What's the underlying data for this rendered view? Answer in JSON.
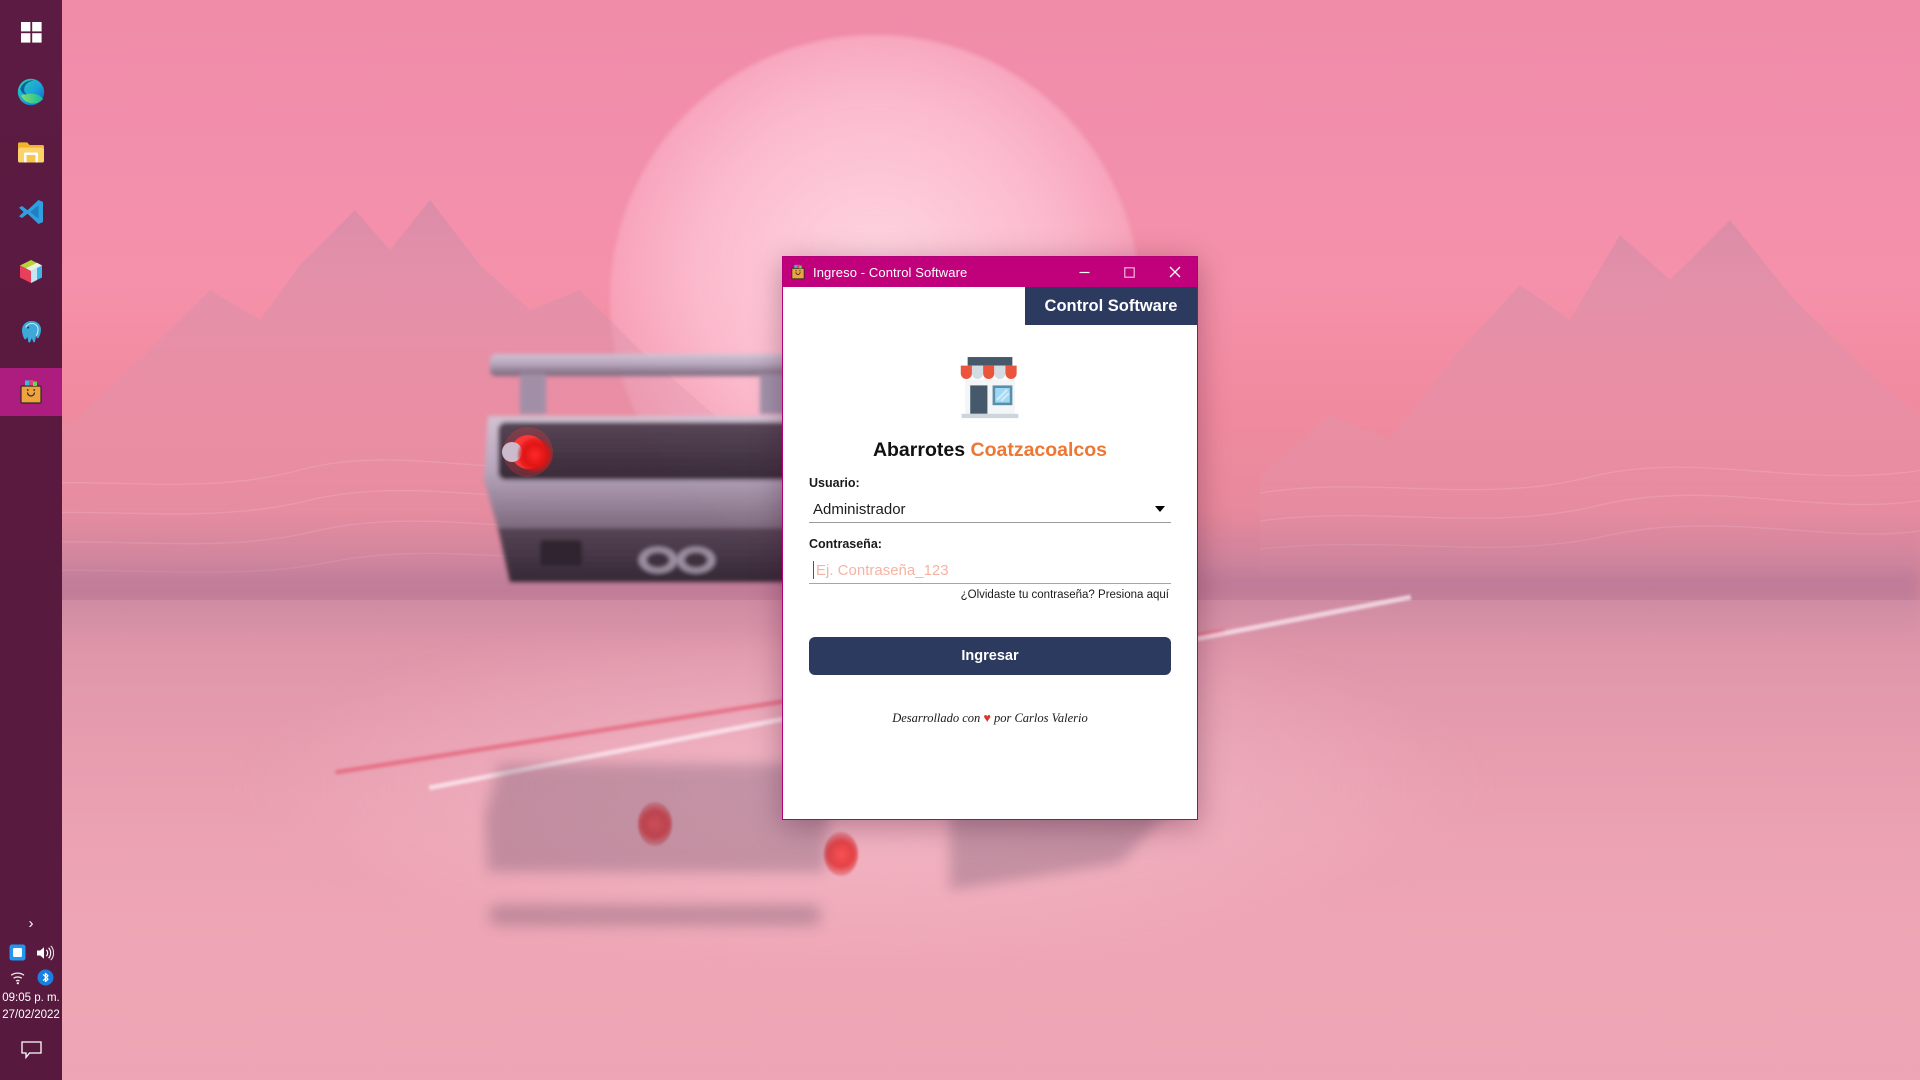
{
  "desktop": {
    "wallpaper_description": "synthwave pink sunset with mountains, sun and sports car on wet salt flat",
    "accent_magenta": "#c1007c",
    "taskbar_color": "#5a1a40",
    "navy": "#2d3a5f",
    "orange": "#ee7733",
    "salmon": "#ef8b72"
  },
  "taskbar": {
    "items": [
      {
        "name": "start-button",
        "icon": "windows-logo-icon",
        "label": "Inicio",
        "active": false
      },
      {
        "name": "taskbar-item-edge",
        "icon": "microsoft-edge-icon",
        "label": "Microsoft Edge",
        "active": false
      },
      {
        "name": "taskbar-item-file-explorer",
        "icon": "folder-icon",
        "label": "Explorador de archivos",
        "active": false
      },
      {
        "name": "taskbar-item-vscode",
        "icon": "vs-code-icon",
        "label": "Visual Studio Code",
        "active": false
      },
      {
        "name": "taskbar-item-3d-viewer",
        "icon": "cube-3d-icon",
        "label": "Visor 3D",
        "active": false
      },
      {
        "name": "taskbar-item-postgresql",
        "icon": "elephant-icon",
        "label": "PostgreSQL",
        "active": false
      },
      {
        "name": "taskbar-item-control-software",
        "icon": "shopping-bag-icon",
        "label": "Ingreso - Control Software",
        "active": true
      }
    ],
    "tray": {
      "chevron_label": "Mostrar iconos ocultos",
      "icons": [
        {
          "name": "tray-display-icon",
          "icon": "monitor-icon"
        },
        {
          "name": "tray-volume-icon",
          "icon": "speaker-icon"
        },
        {
          "name": "tray-network-icon",
          "icon": "wifi-icon"
        },
        {
          "name": "tray-bluetooth-icon",
          "icon": "bluetooth-icon"
        }
      ],
      "clock_time": "09:05 p. m.",
      "clock_date": "27/02/2022",
      "notification_icon": "action-center-icon"
    }
  },
  "window": {
    "title": "Ingreso - Control Software",
    "title_icon": "shopping-bag-icon",
    "controls": {
      "minimize": "—",
      "maximize": "□",
      "close": "✕"
    },
    "banner_label": "Control Software"
  },
  "login": {
    "logo_icon": "storefront-icon",
    "brand_primary": "Abarrotes",
    "brand_secondary": "Coatzacoalcos",
    "user_label": "Usuario:",
    "user_value": "Administrador",
    "user_options": [
      "Administrador"
    ],
    "password_label": "Contraseña:",
    "password_value": "",
    "password_placeholder": "Ej. Contraseña_123",
    "forgot_link": "¿Olvidaste tu contraseña? Presiona aquí",
    "submit_label": "Ingresar",
    "credit_prefix": "Desarrollado con ",
    "credit_heart": "♥",
    "credit_suffix": " por Carlos Valerio"
  }
}
